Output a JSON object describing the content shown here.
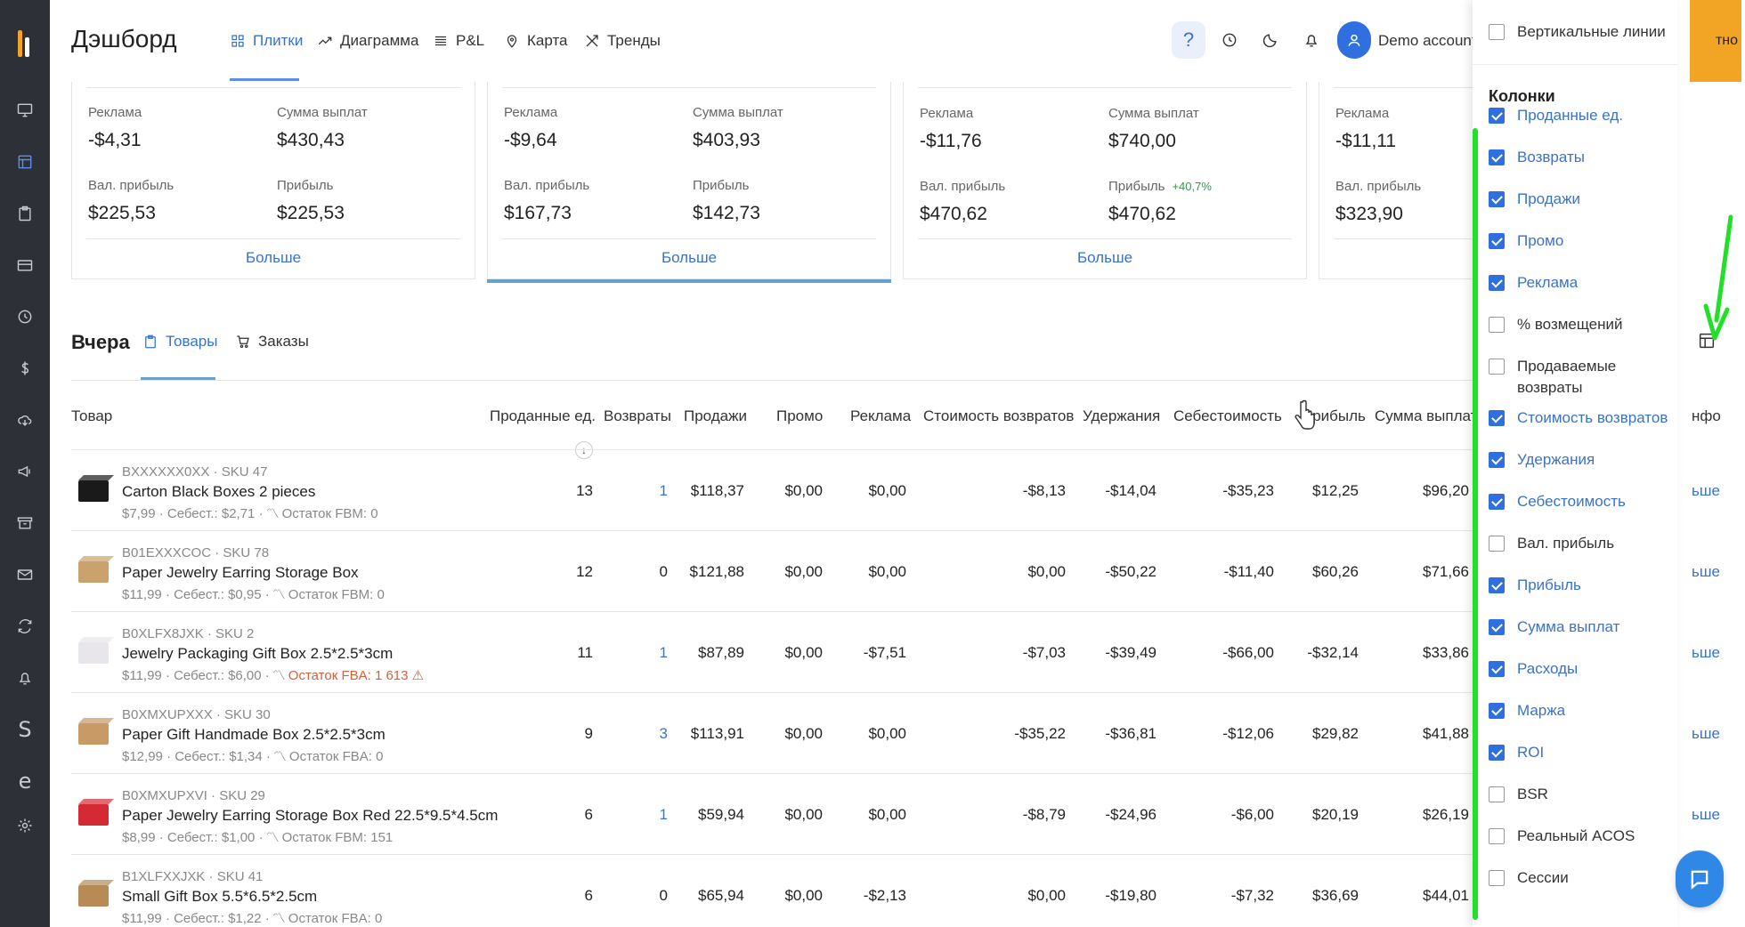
{
  "app": {
    "title": "Дэшборд",
    "nav": [
      {
        "label": "Плитки",
        "icon": "grid-icon"
      },
      {
        "label": "Диаграмма",
        "icon": "trend-line-icon"
      },
      {
        "label": "P&L",
        "icon": "list-icon"
      },
      {
        "label": "Карта",
        "icon": "map-pin-icon"
      },
      {
        "label": "Тренды",
        "icon": "trends-icon"
      }
    ],
    "help_label": "?",
    "account_name": "Demo account",
    "orange_button_label": "тно"
  },
  "cards": [
    {
      "ads_label": "Реклама",
      "ads_value": "-$4,31",
      "payout_label": "Сумма выплат",
      "payout_value": "$430,43",
      "gross_label": "Вал. прибыль",
      "gross_value": "$225,53",
      "profit_label": "Прибыль",
      "profit_value": "$225,53",
      "profit_delta": "",
      "more": "Больше"
    },
    {
      "ads_label": "Реклама",
      "ads_value": "-$9,64",
      "payout_label": "Сумма выплат",
      "payout_value": "$403,93",
      "gross_label": "Вал. прибыль",
      "gross_value": "$167,73",
      "profit_label": "Прибыль",
      "profit_value": "$142,73",
      "profit_delta": "",
      "more": "Больше"
    },
    {
      "ads_label": "Реклама",
      "ads_value": "-$11,76",
      "payout_label": "Сумма выплат",
      "payout_value": "$740,00",
      "gross_label": "Вал. прибыль",
      "gross_value": "$470,62",
      "profit_label": "Прибыль",
      "profit_value": "$470,62",
      "profit_delta": "+40,7%",
      "more": "Больше"
    },
    {
      "ads_label": "Реклама",
      "ads_value": "-$11,11",
      "gross_label": "Вал. прибыль",
      "gross_value": "$323,90"
    }
  ],
  "section": {
    "title": "Вчера",
    "tabs": [
      {
        "label": "Товары"
      },
      {
        "label": "Заказы"
      }
    ]
  },
  "table": {
    "headers": {
      "product": "Товар",
      "units": "Проданные ед.",
      "returns": "Возвраты",
      "sales": "Продажи",
      "promo": "Промо",
      "ads": "Реклама",
      "return_cost": "Стоимость возвратов",
      "fees": "Удержания",
      "cogs": "Себестоимость",
      "profit": "Прибыль",
      "payout": "Сумма выплат",
      "info": "нфо"
    },
    "rows": [
      {
        "sku": "BXXXXXX0XX · SKU 47",
        "name": "Carton Black Boxes 2 pieces",
        "price": "$7,99",
        "cost": "· Себест.: $2,71 ·",
        "stock": "Остаток FBM: 0",
        "units": "13",
        "returns": "1",
        "sales": "$118,37",
        "promo": "$0,00",
        "ads": "$0,00",
        "return_cost": "-$8,13",
        "fees": "-$14,04",
        "cogs": "-$35,23",
        "profit": "$12,25",
        "payout": "$96,20",
        "more": "ьше"
      },
      {
        "sku": "B01EXXXCOC · SKU 78",
        "name": "Paper Jewelry Earring Storage Box",
        "price": "$11,99",
        "cost": "· Себест.: $0,95 ·",
        "stock": "Остаток FBM: 0",
        "units": "12",
        "returns": "0",
        "sales": "$121,88",
        "promo": "$0,00",
        "ads": "$0,00",
        "return_cost": "$0,00",
        "fees": "-$50,22",
        "cogs": "-$11,40",
        "profit": "$60,26",
        "payout": "$71,66",
        "more": "ьше"
      },
      {
        "sku": "B0XLFX8JXK · SKU 2",
        "name": "Jewelry Packaging Gift Box 2.5*2.5*3cm",
        "price": "$11,99",
        "cost": "· Себест.: $6,00 ·",
        "stock": "Остаток FBA: 1 613 ⚠",
        "units": "11",
        "returns": "1",
        "sales": "$87,89",
        "promo": "$0,00",
        "ads": "-$7,51",
        "return_cost": "-$7,03",
        "fees": "-$39,49",
        "cogs": "-$66,00",
        "profit": "-$32,14",
        "payout": "$33,86",
        "more": "ьше"
      },
      {
        "sku": "B0XMXUPXXX · SKU 30",
        "name": "Paper Gift Handmade Box 2.5*2.5*3cm",
        "price": "$12,99",
        "cost": "· Себест.: $1,34 ·",
        "stock": "Остаток FBA: 0",
        "units": "9",
        "returns": "3",
        "sales": "$113,91",
        "promo": "$0,00",
        "ads": "$0,00",
        "return_cost": "-$35,22",
        "fees": "-$36,81",
        "cogs": "-$12,06",
        "profit": "$29,82",
        "payout": "$41,88",
        "more": "ьше"
      },
      {
        "sku": "B0XMXUPXVI · SKU 29",
        "name": "Paper Jewelry Earring Storage Box Red 22.5*9.5*4.5cm",
        "price": "$8,99",
        "cost": "· Себест.: $1,00 ·",
        "stock": "Остаток FBM: 151",
        "units": "6",
        "returns": "1",
        "sales": "$59,94",
        "promo": "$0,00",
        "ads": "$0,00",
        "return_cost": "-$8,79",
        "fees": "-$24,96",
        "cogs": "-$6,00",
        "profit": "$20,19",
        "payout": "$26,19",
        "more": "ьше"
      },
      {
        "sku": "B1XLFXXJXK · SKU 41",
        "name": "Small Gift Box 5.5*6.5*2.5cm",
        "price": "$11,99",
        "cost": "· Себест.: $1,22 ·",
        "stock": "Остаток FBA: 0",
        "units": "6",
        "returns": "0",
        "sales": "$65,94",
        "promo": "$0,00",
        "ads": "-$2,13",
        "return_cost": "$0,00",
        "fees": "-$19,80",
        "cogs": "-$7,32",
        "profit": "$36,69",
        "payout": "$44,01",
        "more": ""
      }
    ]
  },
  "column_panel": {
    "vertical_lines": {
      "label": "Вертикальные линии",
      "checked": false
    },
    "group_title": "Колонки",
    "options": [
      {
        "label": "Проданные ед.",
        "checked": true
      },
      {
        "label": "Возвраты",
        "checked": true
      },
      {
        "label": "Продажи",
        "checked": true
      },
      {
        "label": "Промо",
        "checked": true
      },
      {
        "label": "Реклама",
        "checked": true
      },
      {
        "label": "% возмещений",
        "checked": false
      },
      {
        "label": "Продаваемые возвраты",
        "checked": false
      },
      {
        "label": "Стоимость возвратов",
        "checked": true
      },
      {
        "label": "Удержания",
        "checked": true
      },
      {
        "label": "Себестоимость",
        "checked": true
      },
      {
        "label": "Вал. прибыль",
        "checked": false
      },
      {
        "label": "Прибыль",
        "checked": true
      },
      {
        "label": "Сумма выплат",
        "checked": true
      },
      {
        "label": "Расходы",
        "checked": true
      },
      {
        "label": "Маржа",
        "checked": true
      },
      {
        "label": "ROI",
        "checked": true
      },
      {
        "label": "BSR",
        "checked": false
      },
      {
        "label": "Реальный ACOS",
        "checked": false
      },
      {
        "label": "Сессии",
        "checked": false
      }
    ]
  },
  "colors": {
    "accent": "#3a72c9",
    "brand_orange": "#f2a424",
    "annotation_green": "#22e02a",
    "rail": "#2d3036"
  }
}
